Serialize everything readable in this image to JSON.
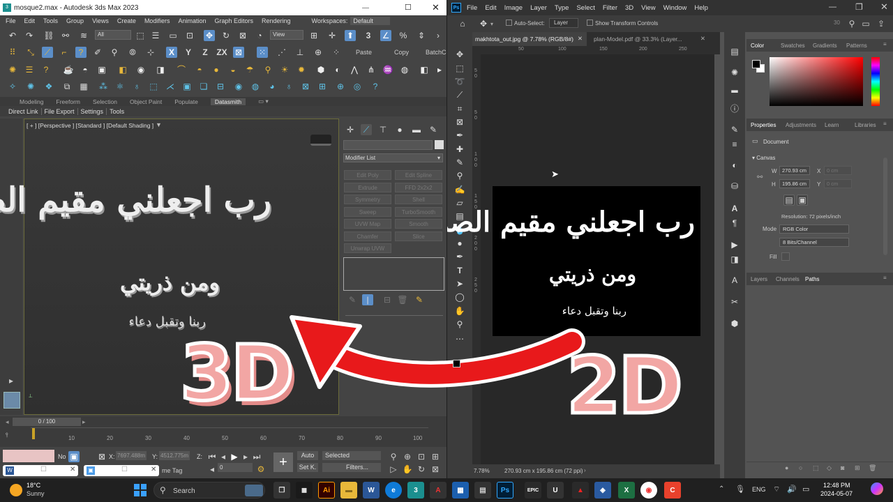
{
  "max": {
    "title": "mosque2.max - Autodesk 3ds Max 2023",
    "workspace_label": "Workspaces:",
    "workspace_value": "Default",
    "menu": [
      "File",
      "Edit",
      "Tools",
      "Group",
      "Views",
      "Create",
      "Modifiers",
      "Animation",
      "Graph Editors",
      "Rendering"
    ],
    "toolbar": {
      "selection_filter": "All",
      "view": "View",
      "paste": "Paste",
      "copy": "Copy",
      "batch": "BatchCo"
    },
    "ribbon_tabs": [
      "Modeling",
      "Freeform",
      "Selection",
      "Object Paint",
      "Populate",
      "Datasmith"
    ],
    "sub_tabs": [
      "Direct Link",
      "File Export",
      "Settings",
      "Tools"
    ],
    "viewport_label": "[ + ] [Perspective ] [Standard ] [Default Shading ]",
    "modifier_list": "Modifier List",
    "modifier_buttons": [
      "Edit Poly",
      "Edit Spline",
      "Extrude",
      "FFD 2x2x2",
      "Symmetry",
      "Shell",
      "Sweep",
      "TurboSmooth",
      "UVW Map",
      "Smooth",
      "Chamfer",
      "Slice",
      "Unwrap UVW"
    ],
    "time_slider": "0 / 100",
    "ticks": [
      "10",
      "20",
      "30",
      "40",
      "50",
      "60",
      "70",
      "80",
      "90",
      "100"
    ],
    "status": {
      "no_label": "No",
      "x_label": "X:",
      "x_value": "7697.488m",
      "y_label": "Y:",
      "y_value": "4512.775m",
      "z_label": "Z:",
      "frame": "0",
      "auto": "Auto",
      "selected": "Selected",
      "set_key": "Set K.",
      "filters": "Filters...",
      "time_tag": "me Tag"
    }
  },
  "overlay": {
    "left_text": "3D",
    "right_text": "2D"
  },
  "calligraphy": {
    "line1": "رب اجعلني مقيم الصلاة",
    "line2": "ومن ذريتي",
    "line3": "ربنا وتقبل دعاء"
  },
  "ps": {
    "menu": [
      "File",
      "Edit",
      "Image",
      "Layer",
      "Type",
      "Select",
      "Filter",
      "3D",
      "View",
      "Window",
      "Help"
    ],
    "auto_select": "Auto-Select:",
    "layer_dropdown": "Layer",
    "transform_controls": "Show Transform Controls",
    "zoom_3d": "30",
    "tab1": "makhtota_out.jpg @ 7.78% (RGB/8#)",
    "tab2": "plan-Model.pdf @ 33.3% (Layer...",
    "ruler_top": [
      "50",
      "100",
      "150",
      "200",
      "250"
    ],
    "ruler_left": [
      "5",
      "0",
      "5",
      "0",
      "1",
      "0",
      "0",
      "1",
      "5",
      "0",
      "2",
      "0",
      "0",
      "2",
      "5",
      "0"
    ],
    "zoom_status": "7.78%",
    "doc_info": "270.93 cm x 195.86 cm (72 ppi)",
    "color_tabs": [
      "Color",
      "Swatches",
      "Gradients",
      "Patterns"
    ],
    "props_tabs": [
      "Properties",
      "Adjustments",
      "Learn",
      "Libraries"
    ],
    "document_label": "Document",
    "canvas_label": "Canvas",
    "w_label": "W",
    "w_value": "270.93 cm",
    "h_label": "H",
    "h_value": "195.86 cm",
    "x_label": "X",
    "x_value": "0 cm",
    "y_label": "Y",
    "y_value": "0 cm",
    "resolution": "Resolution: 72 pixels/inch",
    "mode_label": "Mode",
    "mode_value": "RGB Color",
    "bits_value": "8 Bits/Channel",
    "fill_label": "Fill",
    "layer_tabs": [
      "Layers",
      "Channels",
      "Paths"
    ]
  },
  "taskbar": {
    "temp": "18°C",
    "weather": "Sunny",
    "search": "Search",
    "lang": "ENG",
    "time": "12:48 PM",
    "date": "2024-05-07"
  },
  "colors": {
    "arrow": "#e8191b",
    "overlay_fill": "#f2a6a4",
    "ps_accent": "#31a8ff"
  }
}
